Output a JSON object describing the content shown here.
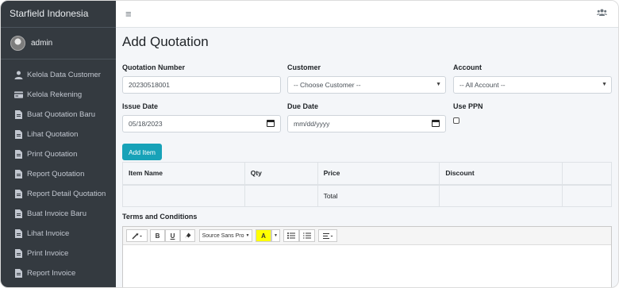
{
  "sidebar": {
    "brand": "Starfield Indonesia",
    "user": "admin",
    "items": [
      {
        "label": "Kelola Data Customer",
        "icon": "user-icon"
      },
      {
        "label": "Kelola Rekening",
        "icon": "card-icon"
      },
      {
        "label": "Buat Quotation Baru",
        "icon": "file-icon"
      },
      {
        "label": "Lihat Quotation",
        "icon": "file-icon"
      },
      {
        "label": "Print Quotation",
        "icon": "file-icon"
      },
      {
        "label": "Report Quotation",
        "icon": "file-icon"
      },
      {
        "label": "Report Detail Quotation",
        "icon": "file-icon"
      },
      {
        "label": "Buat Invoice Baru",
        "icon": "file-icon"
      },
      {
        "label": "Lihat Invoice",
        "icon": "file-icon"
      },
      {
        "label": "Print Invoice",
        "icon": "file-icon"
      },
      {
        "label": "Report Invoice",
        "icon": "file-icon"
      }
    ]
  },
  "topbar": {
    "menu_icon": "≡"
  },
  "page": {
    "title": "Add Quotation"
  },
  "form": {
    "quotation_number_label": "Quotation Number",
    "quotation_number_value": "20230518001",
    "customer_label": "Customer",
    "customer_value": "-- Choose Customer --",
    "account_label": "Account",
    "account_value": "-- All Account --",
    "issue_date_label": "Issue Date",
    "issue_date_value": "05/18/2023",
    "due_date_label": "Due Date",
    "due_date_value": "mm/dd/yyyy",
    "use_ppn_label": "Use PPN",
    "use_ppn_checked": false,
    "add_item_label": "Add Item"
  },
  "items_table": {
    "headers": [
      "Item Name",
      "Qty",
      "Price",
      "Discount",
      ""
    ],
    "total_label": "Total"
  },
  "terms": {
    "label": "Terms and Conditions",
    "font_label": "Source Sans Pro",
    "bold": "B",
    "underline": "U",
    "color": "A"
  }
}
